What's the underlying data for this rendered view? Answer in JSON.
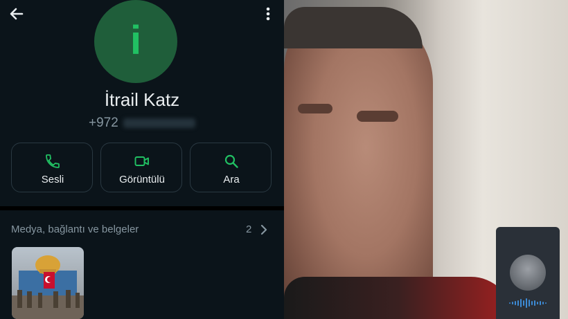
{
  "header": {
    "back_icon": "arrow-left-icon",
    "menu_icon": "more-vertical-icon"
  },
  "contact": {
    "avatar_letter": "i",
    "name": "İtrail Katz",
    "phone_prefix": "+972"
  },
  "actions": [
    {
      "label": "Sesli",
      "icon": "phone-icon"
    },
    {
      "label": "Görüntülü",
      "icon": "video-icon"
    },
    {
      "label": "Ara",
      "icon": "search-icon"
    }
  ],
  "media": {
    "title": "Medya, bağlantı ve belgeler",
    "count": "2"
  },
  "colors": {
    "accent": "#21c063",
    "background": "#0b141a",
    "text": "#e9edef",
    "muted": "#8696a0"
  }
}
